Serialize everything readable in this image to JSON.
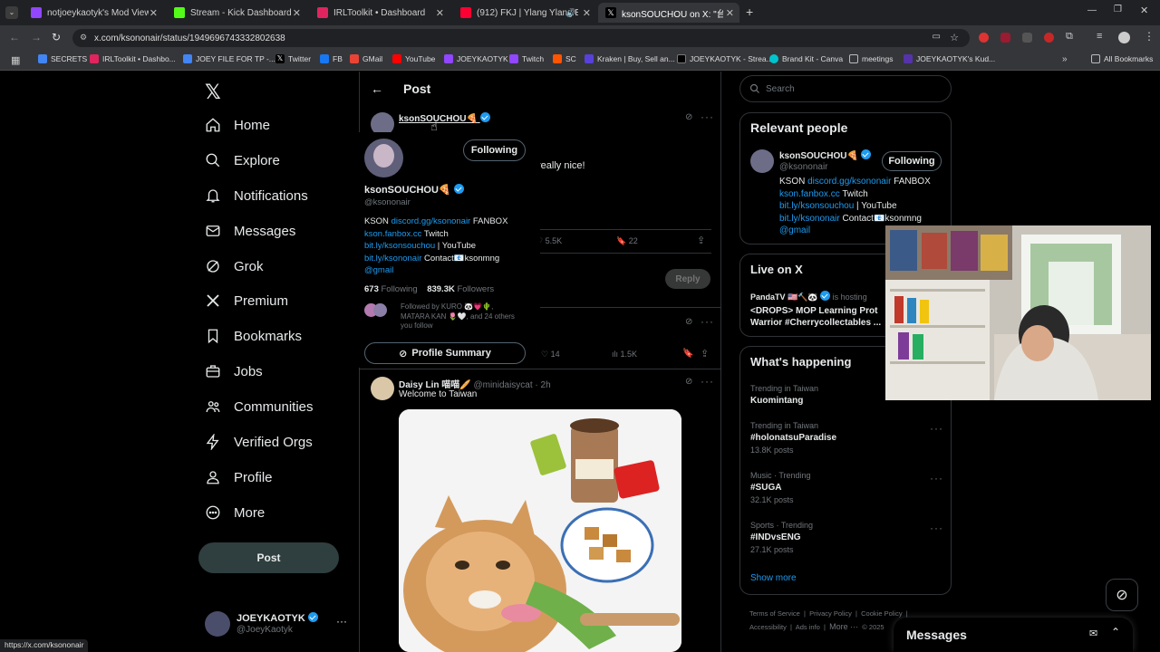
{
  "browser": {
    "tabs": [
      {
        "title": "notjoeykaotyk's Mod View - Tw",
        "color": "#9146ff"
      },
      {
        "title": "Stream - Kick Dashboard",
        "color": "#53fc18"
      },
      {
        "title": "IRLToolkit • Dashboard",
        "color": "#e0245e"
      },
      {
        "title": "(912) FKJ | Ylang Ylang EP (",
        "color": "#ff0033"
      },
      {
        "title": "ksonSOUCHOU on X: \"台湾",
        "color": "#ffffff"
      }
    ],
    "url": "x.com/ksononair/status/1949696743332802638",
    "bookmarks": [
      "SECRETS",
      "IRLToolkit • Dashbo...",
      "JOEY FILE FOR TP -...",
      "Twitter",
      "FB",
      "GMail",
      "YouTube",
      "JOEYKAOTYK",
      "Twitch",
      "SC",
      "Kraken | Buy, Sell an...",
      "JOEYKAOTYK - Strea...",
      "Brand Kit - Canva",
      "meetings",
      "JOEYKAOTYK's Kud..."
    ],
    "all_bookmarks": "All Bookmarks",
    "status_url": "https://x.com/ksononair"
  },
  "nav": {
    "items": [
      "Home",
      "Explore",
      "Notifications",
      "Messages",
      "Grok",
      "Premium",
      "Bookmarks",
      "Jobs",
      "Communities",
      "Verified Orgs",
      "Profile",
      "More"
    ],
    "post_button": "Post",
    "account_name": "JOEYKAOTYK",
    "account_handle": "@JoeyKaotyk"
  },
  "main": {
    "header": "Post",
    "tweet": {
      "name": "ksonSOUCHOU",
      "emoji": "🍕",
      "text_tail": "really nice!",
      "likes": "5.5K",
      "bookmarks": "22",
      "reply_button": "Reply"
    },
    "reply2": {
      "likes": "14",
      "views": "1.5K"
    },
    "reply3": {
      "name": "Daisy Lin 喵喵🥖",
      "handle": "@minidaisycat",
      "time": "· 2h",
      "text": "Welcome to Taiwan"
    }
  },
  "hovercard": {
    "following_btn": "Following",
    "name": "ksonSOUCHOU",
    "emoji": "🍕",
    "handle": "@ksononair",
    "bio_line1_a": "KSON ",
    "bio_line1_link": "discord.gg/ksononair",
    "bio_line1_b": " FANBOX",
    "bio_line2_link": "kson.fanbox.cc",
    "bio_line2_b": " Twitch",
    "bio_line3_link": "bit.ly/ksonsouchou",
    "bio_line3_b": " | YouTube",
    "bio_line4_link": "bit.ly/ksononair",
    "bio_line4_b": " Contact📧ksonmng",
    "bio_line5_link": "@gmail",
    "following_count": "673",
    "following_label": "Following",
    "followers_count": "839.3K",
    "followers_label": "Followers",
    "followed_by": "Followed by KURO 🐼💗🌵, MATARA KAN 🌷🤍, and 24 others you follow",
    "summary_btn": "Profile Summary"
  },
  "right": {
    "search_placeholder": "Search",
    "relevant_title": "Relevant people",
    "person": {
      "name": "ksonSOUCHOU",
      "handle": "@ksononair",
      "follow_btn": "Following"
    },
    "live_title": "Live on X",
    "live": {
      "host": "PandaTV 🇺🇸🔨🐼",
      "hosting": "is hosting",
      "title": "<DROPS> MOP Learning Prot Warrior #Cherrycollectables ..."
    },
    "happening_title": "What's happening",
    "trends": [
      {
        "context": "Trending in Taiwan",
        "name": "Kuomintang",
        "posts": ""
      },
      {
        "context": "Trending in Taiwan",
        "name": "#holonatsuParadise",
        "posts": "13.8K posts"
      },
      {
        "context": "Music · Trending",
        "name": "#SUGA",
        "posts": "32.1K posts"
      },
      {
        "context": "Sports · Trending",
        "name": "#INDvsENG",
        "posts": "27.1K posts"
      }
    ],
    "show_more": "Show more",
    "footer": [
      "Terms of Service",
      "Privacy Policy",
      "Cookie Policy",
      "Accessibility",
      "Ads info",
      "More ···",
      "© 2025"
    ],
    "messages": "Messages"
  },
  "colors": {
    "accent": "#1d9bf0",
    "bg": "#000000",
    "border": "#2f3336"
  }
}
